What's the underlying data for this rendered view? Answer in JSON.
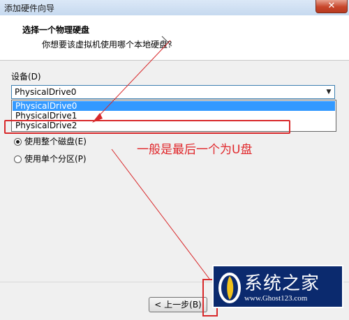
{
  "window": {
    "title": "添加硬件向导",
    "close_glyph": "✕"
  },
  "header": {
    "title": "选择一个物理硬盘",
    "subtitle": "你想要该虚拟机使用哪个本地硬盘？"
  },
  "device": {
    "label": "设备(D)",
    "selected": "PhysicalDrive0",
    "options": [
      "PhysicalDrive0",
      "PhysicalDrive1",
      "PhysicalDrive2"
    ]
  },
  "usage": {
    "whole_disk": "使用整个磁盘(E)",
    "single_partition": "使用单个分区(P)",
    "selected": "whole_disk"
  },
  "annotation": {
    "text": "一般是最后一个为U盘",
    "color": "#e0262a"
  },
  "footer": {
    "back_label": "< 上一步(B)"
  },
  "logo": {
    "name": "系统之家",
    "url": "www.Ghost123.com"
  },
  "colors": {
    "selection": "#3399ff",
    "annotation_red": "#d8282a",
    "logo_bg": "#0b2a6e"
  }
}
